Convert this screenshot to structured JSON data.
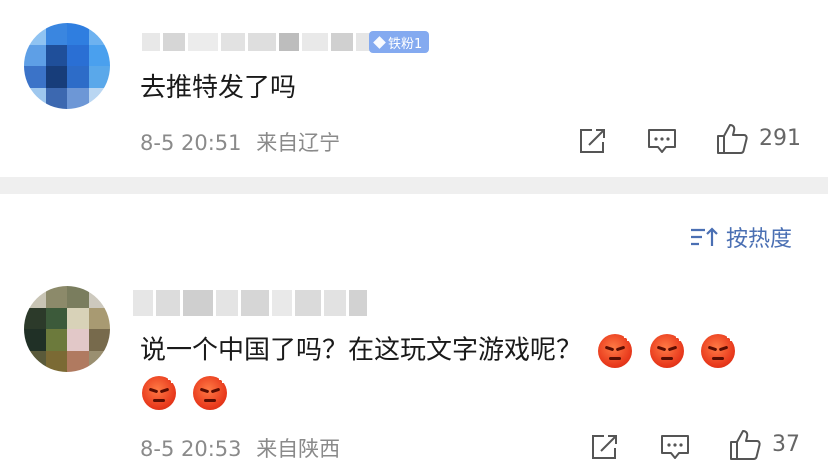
{
  "comments": [
    {
      "badge": "铁粉1",
      "text": "去推特发了吗",
      "date": "8-5 20:51",
      "location": "来自辽宁",
      "likes": "291"
    },
    {
      "text": "说一个中国了吗？在这玩文字游戏呢？",
      "date": "8-5 20:53",
      "location": "来自陕西",
      "likes": "37",
      "emoji_count": 5
    }
  ],
  "sort": {
    "label": "按热度"
  },
  "icons": {
    "share": "share-icon",
    "comment": "comment-icon",
    "like": "thumbs-up-icon",
    "sort": "sort-icon",
    "badge": "diamond-icon",
    "emoji": "angry-face-emoji"
  },
  "colors": {
    "badge_bg": "#84aaf0",
    "meta_text": "#8a8a8a",
    "sort_link": "#4a6fb3",
    "separator": "#efefef"
  }
}
